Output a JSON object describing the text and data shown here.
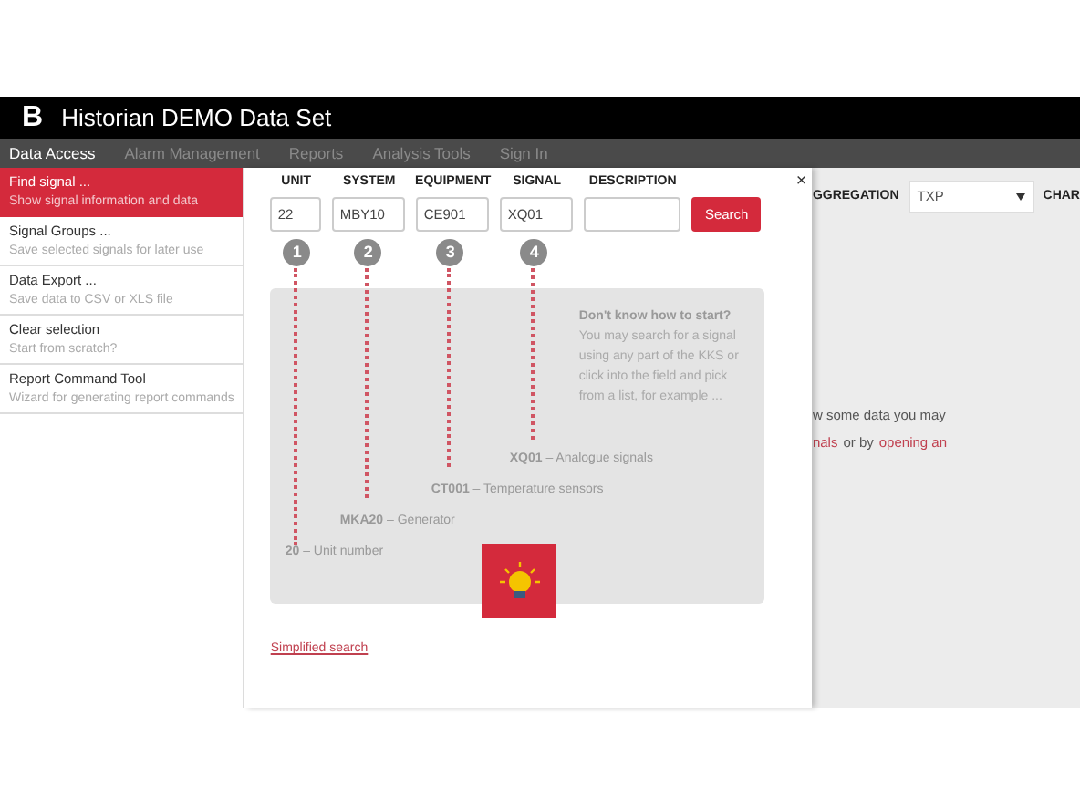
{
  "app": {
    "title": "Historian DEMO Data Set",
    "logo": "B"
  },
  "nav": [
    {
      "label": "Data Access",
      "selected": true
    },
    {
      "label": "Alarm Management",
      "selected": false
    },
    {
      "label": "Reports",
      "selected": false
    },
    {
      "label": "Analysis Tools",
      "selected": false
    },
    {
      "label": "Sign In",
      "selected": false
    }
  ],
  "sidebar": {
    "items": [
      {
        "title": "Find signal ...",
        "subtitle": "Show signal information and data",
        "selected": true
      },
      {
        "title": "Signal Groups ...",
        "subtitle": "Save selected signals for later use",
        "selected": false
      },
      {
        "title": "Data Export ...",
        "subtitle": "Save data to CSV or XLS file",
        "selected": false
      },
      {
        "title": "Clear selection",
        "subtitle": "Start from scratch?",
        "selected": false
      },
      {
        "title": "Report Command Tool",
        "subtitle": "Wizard for generating report commands",
        "selected": false
      }
    ]
  },
  "search_dialog": {
    "fields": [
      {
        "label": "UNIT",
        "value": "22",
        "step": "1"
      },
      {
        "label": "SYSTEM",
        "value": "MBY10",
        "step": "2"
      },
      {
        "label": "EQUIPMENT",
        "value": "CE901",
        "step": "3"
      },
      {
        "label": "SIGNAL",
        "value": "XQ01",
        "step": "4"
      },
      {
        "label": "DESCRIPTION"
      }
    ],
    "search_button": "Search",
    "close": "×",
    "tip": {
      "title": "Don't know how to start?",
      "text": "You may search for a signal using any part of the KKS or click into the field and pick from a list, for example ..."
    },
    "examples": [
      "**XQ01** – Analogue signals",
      "**CT001** – Temperature sensors",
      "**MKA20** – Generator",
      "**20** – Unit number"
    ],
    "simplified_search_link": "Simplified search"
  },
  "right_panel": {
    "aggregation_label": "GGREGATION",
    "aggregation_value": "TXP",
    "chart_label": "CHAR",
    "message_line": "w some data you may",
    "message_parts": [
      {
        "text": "nals",
        "kind": "link"
      },
      {
        "text": "or by",
        "kind": "text"
      },
      {
        "text": "opening an",
        "kind": "link"
      }
    ]
  }
}
